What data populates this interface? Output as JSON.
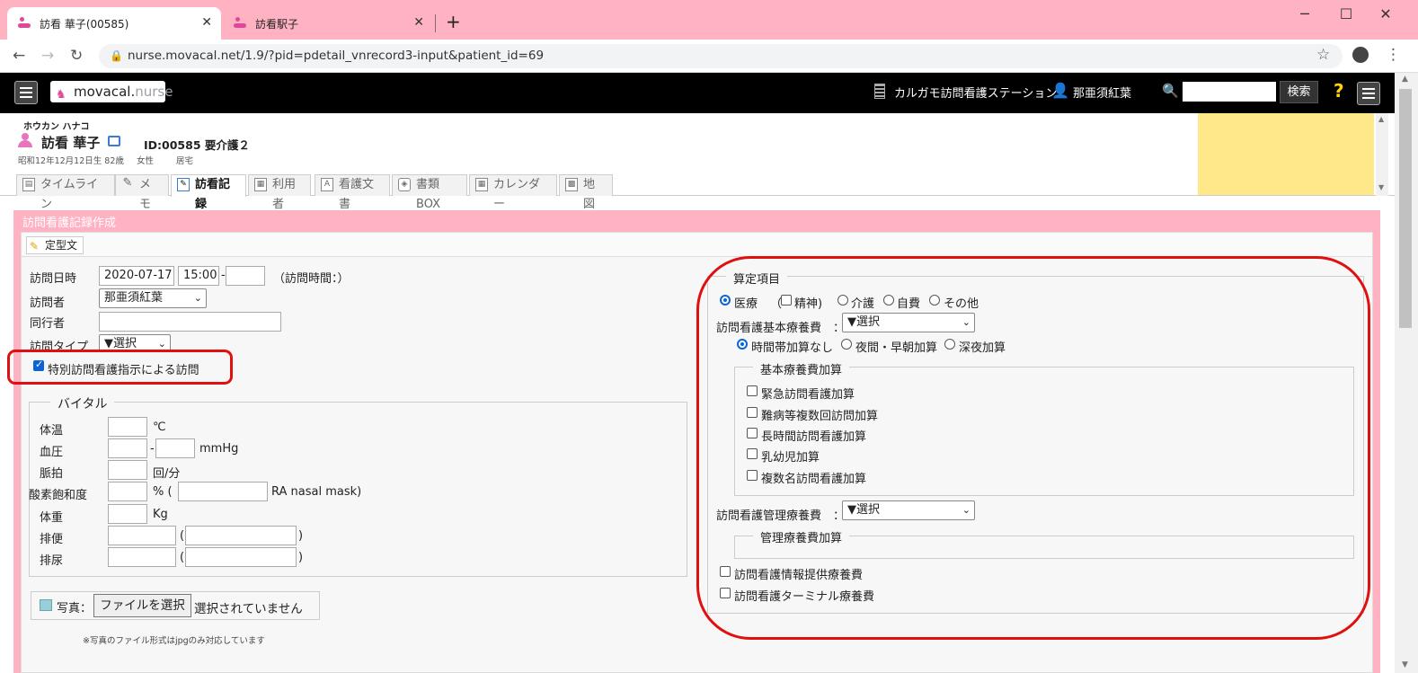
{
  "browser": {
    "tabs": [
      {
        "title": "訪看 華子(00585)",
        "active": true
      },
      {
        "title": "訪看駅子",
        "active": false
      }
    ],
    "new_tab": "+",
    "url": "nurse.movacal.net/1.9/?pid=pdetail_vnrecord3-input&patient_id=69",
    "window_controls": [
      "─",
      "☐",
      "✕"
    ]
  },
  "app": {
    "logo_main": "movacal.",
    "logo_sub": "nurse",
    "station": "カルガモ訪問看護ステーション",
    "user": "那亜須紅葉",
    "search_button": "検索",
    "help": "?"
  },
  "patient": {
    "kana": "ホウカン ハナコ",
    "name": "訪看 華子",
    "id_line": "ID:00585 要介護２",
    "birth": "昭和12年12月12日生 82歳",
    "sex": "女性",
    "residence": "居宅"
  },
  "subtabs": [
    {
      "label": "タイムライン",
      "active": false
    },
    {
      "label": "メモ",
      "active": false
    },
    {
      "label": "訪看記録",
      "active": true
    },
    {
      "label": "利用者",
      "active": false
    },
    {
      "label": "看護文書",
      "active": false
    },
    {
      "label": "書類BOX",
      "active": false
    },
    {
      "label": "カレンダー",
      "active": false
    },
    {
      "label": "地図",
      "active": false
    }
  ],
  "panel": {
    "title": "訪問看護記録作成",
    "template_button": "定型文"
  },
  "form": {
    "visit_date_label": "訪問日時",
    "visit_date": "2020-07-17",
    "visit_start": "15:00",
    "visit_dash": "-",
    "visit_end": "",
    "visit_duration": "（訪問時間：）",
    "visitor_label": "訪問者",
    "visitor": "那亜須紅葉",
    "companion_label": "同行者",
    "companion": "",
    "visit_type_label": "訪問タイプ",
    "visit_type": "▼選択",
    "special_visit_label": "特別訪問看護指示による訪問",
    "special_visit_checked": true
  },
  "vitals": {
    "legend": "バイタル",
    "rows": [
      {
        "label": "体温",
        "unit": "℃"
      },
      {
        "label": "血圧",
        "sep": "-",
        "unit": "mmHg"
      },
      {
        "label": "脈拍",
        "unit": "回/分"
      },
      {
        "label": "酸素飽和度",
        "unit": "% (",
        "unit2": "RA nasal mask)"
      },
      {
        "label": "体重",
        "unit": "Kg"
      },
      {
        "label": "排便",
        "open": "(",
        "close": ")"
      },
      {
        "label": "排尿",
        "open": "(",
        "close": ")"
      }
    ]
  },
  "photo": {
    "label": "写真：",
    "button": "ファイルを選択",
    "status": "選択されていません",
    "note": "※写真のファイル形式はjpgのみ対応しています"
  },
  "billing": {
    "legend": "算定項目",
    "insurance_options": [
      {
        "label": "医療",
        "checked": true
      },
      {
        "label": "介護",
        "checked": false
      },
      {
        "label": "自費",
        "checked": false
      },
      {
        "label": "その他",
        "checked": false
      }
    ],
    "mental_open": "（",
    "mental_label": "精神)",
    "basic_fee_label": "訪問看護基本療養費",
    "colon": "：",
    "basic_fee_select": "▼選択",
    "time_options": [
      {
        "label": "時間帯加算なし",
        "checked": true
      },
      {
        "label": "夜間・早朝加算",
        "checked": false
      },
      {
        "label": "深夜加算",
        "checked": false
      }
    ],
    "basic_additions_legend": "基本療養費加算",
    "basic_additions": [
      "緊急訪問看護加算",
      "難病等複数回訪問加算",
      "長時間訪問看護加算",
      "乳幼児加算",
      "複数名訪問看護加算"
    ],
    "mgmt_fee_label": "訪問看護管理療養費",
    "mgmt_fee_select": "▼選択",
    "mgmt_additions_legend": "管理療養費加算",
    "info_fee": "訪問看護情報提供療養費",
    "terminal_fee": "訪問看護ターミナル療養費"
  },
  "colors": {
    "tabstrip": "#ffb2c1",
    "panel": "#ffb2c1",
    "highlight": "#e01010",
    "yellow": "#ffe88a"
  }
}
